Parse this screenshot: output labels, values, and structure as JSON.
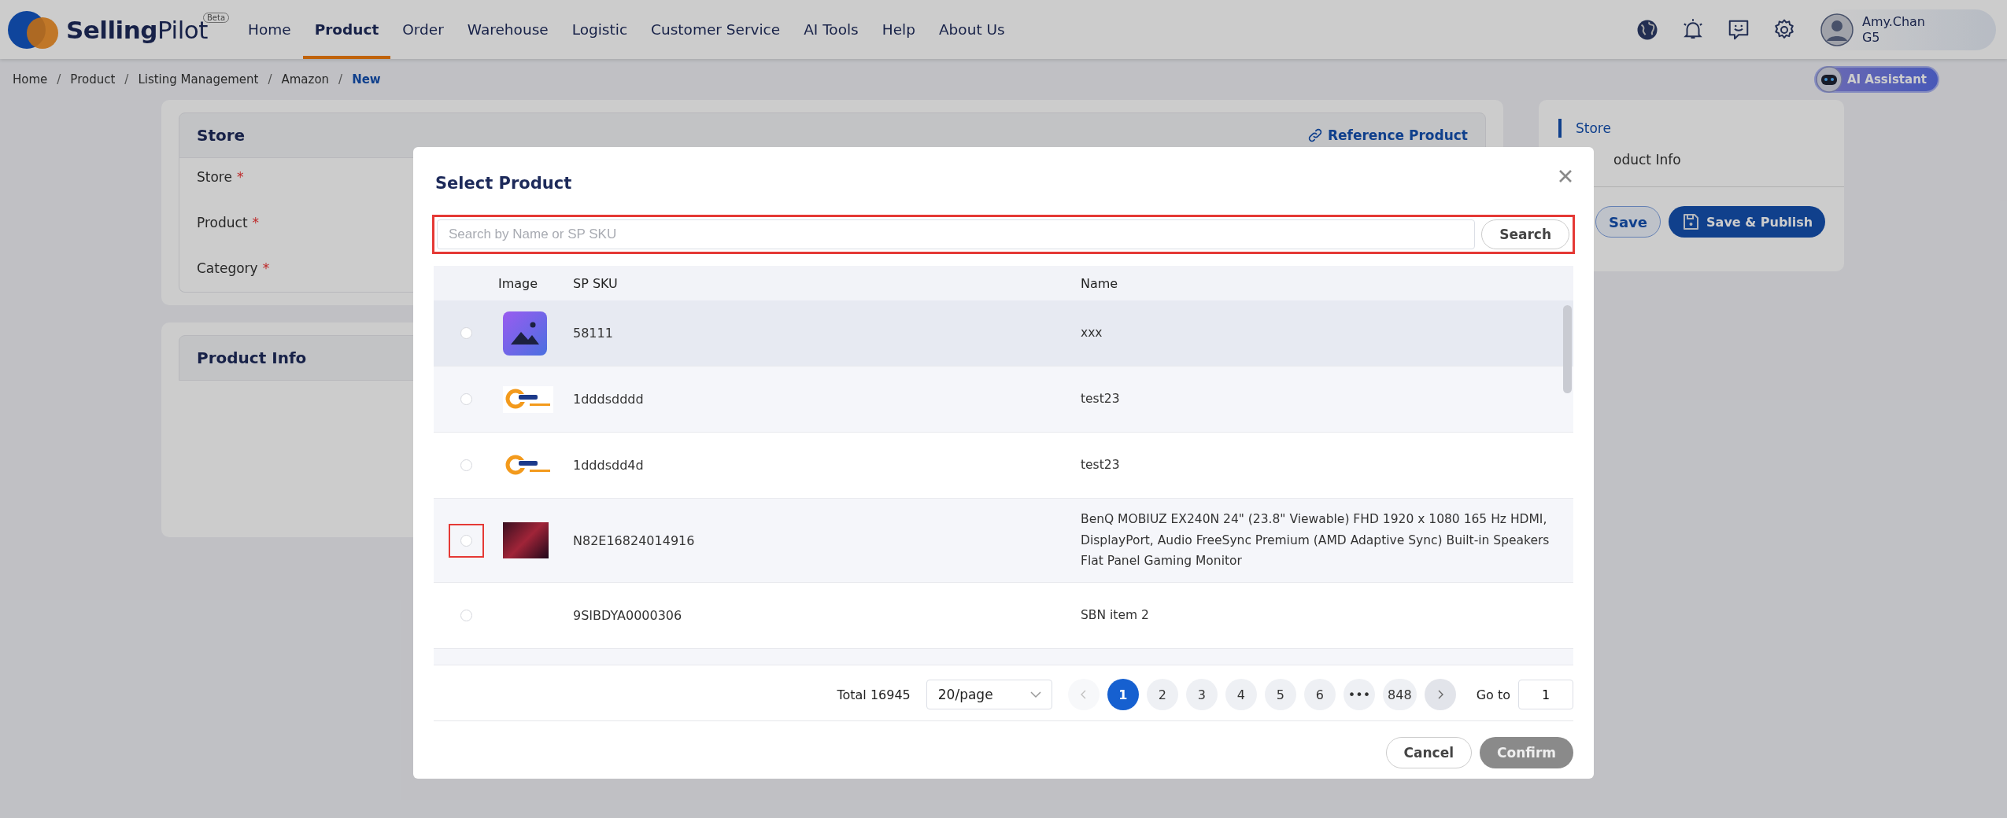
{
  "header": {
    "brand_main": "Selling",
    "brand_sub": "Pilot",
    "brand_badge": "Beta",
    "nav": [
      {
        "label": "Home",
        "selected": false
      },
      {
        "label": "Product",
        "selected": true
      },
      {
        "label": "Order",
        "selected": false
      },
      {
        "label": "Warehouse",
        "selected": false
      },
      {
        "label": "Logistic",
        "selected": false
      },
      {
        "label": "Customer Service",
        "selected": false
      },
      {
        "label": "AI Tools",
        "selected": false
      },
      {
        "label": "Help",
        "selected": false
      },
      {
        "label": "About Us",
        "selected": false
      }
    ],
    "user": {
      "name": "Amy.Chan",
      "level": "G5"
    }
  },
  "breadcrumb_separator": "/",
  "breadcrumb": [
    {
      "label": "Home",
      "current": false
    },
    {
      "label": "Product",
      "current": false
    },
    {
      "label": "Listing Management",
      "current": false
    },
    {
      "label": "Amazon",
      "current": false
    },
    {
      "label": "New",
      "current": true
    }
  ],
  "ai_assistant": "AI Assistant",
  "store_card": {
    "title": "Store",
    "required_mark": "*",
    "reference_link": "Reference Product",
    "fields": [
      {
        "label": "Store",
        "required": true
      },
      {
        "label": "Product",
        "required": true
      },
      {
        "label": "Category",
        "required": true
      }
    ]
  },
  "product_info_card": {
    "title": "Product Info"
  },
  "side_panel": {
    "anchors": [
      {
        "label": "Store",
        "selected": true
      },
      {
        "label": "oduct Info",
        "selected": false
      }
    ],
    "save": "Save",
    "save_publish": "Save & Publish"
  },
  "modal": {
    "title": "Select Product",
    "search": {
      "placeholder": "Search by Name or SP SKU",
      "button": "Search",
      "highlighted": true
    },
    "columns": [
      "Image",
      "SP SKU",
      "Name"
    ],
    "rows": [
      {
        "kind": "placeholder",
        "sku": "58111",
        "name": "xxx",
        "selected": false,
        "hovered": true,
        "highlighted": false
      },
      {
        "kind": "logo",
        "sku": "1dddsdddd",
        "name": "test23",
        "selected": false,
        "hovered": false,
        "highlighted": false
      },
      {
        "kind": "logo",
        "sku": "1dddsdd4d",
        "name": "test23",
        "selected": false,
        "hovered": false,
        "highlighted": false
      },
      {
        "kind": "photo",
        "sku": "N82E16824014916",
        "name": "BenQ MOBIUZ EX240N 24\" (23.8\" Viewable) FHD 1920 x 1080 165 Hz HDMI, DisplayPort, Audio FreeSync Premium (AMD Adaptive Sync) Built-in Speakers Flat Panel Gaming Monitor",
        "selected": false,
        "hovered": false,
        "highlighted": true
      },
      {
        "kind": "none",
        "sku": "9SIBDYA0000306",
        "name": "SBN item 2",
        "selected": false,
        "hovered": false,
        "highlighted": false
      }
    ],
    "pagination": {
      "total": "Total 16945",
      "page_size": "20/page",
      "prev_disabled": true,
      "pages": [
        {
          "label": "1",
          "selected": true
        },
        {
          "label": "2",
          "selected": false
        },
        {
          "label": "3",
          "selected": false
        },
        {
          "label": "4",
          "selected": false
        },
        {
          "label": "5",
          "selected": false
        },
        {
          "label": "6",
          "selected": false
        },
        {
          "label": "•••",
          "selected": false
        },
        {
          "label": "848",
          "selected": false
        }
      ],
      "goto_label": "Go to",
      "goto_value": "1"
    },
    "cancel": "Cancel",
    "confirm": "Confirm",
    "confirm_disabled": true
  }
}
